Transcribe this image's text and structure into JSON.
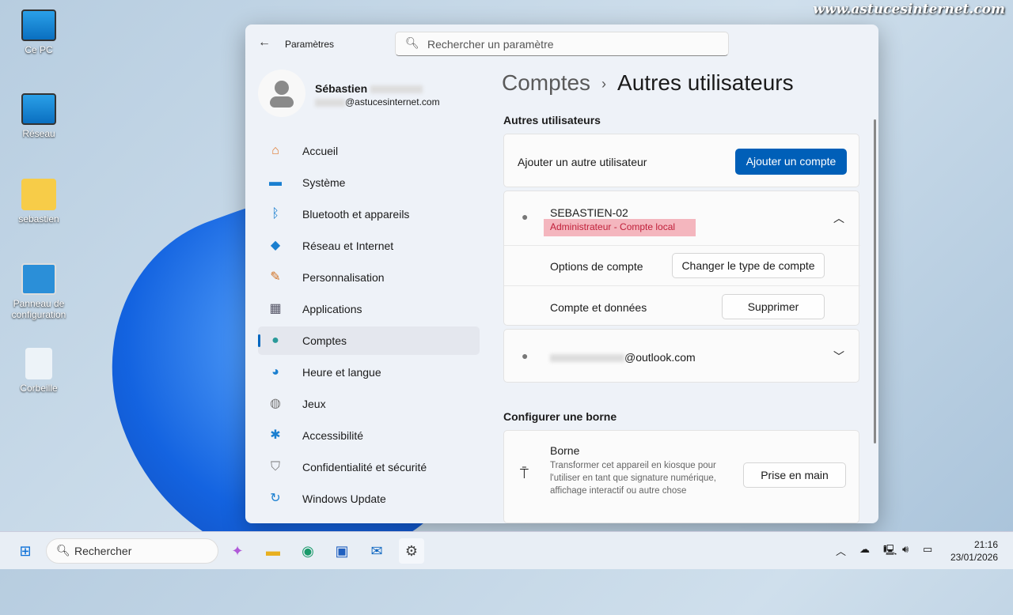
{
  "watermark": "www.astucesinternet.com",
  "desktop": [
    "Ce PC",
    "Réseau",
    "sebastien",
    "Panneau de configuration",
    "Corbeille"
  ],
  "window": {
    "title": "Paramètres",
    "search_placeholder": "Rechercher un paramètre"
  },
  "user": {
    "name": "Sébastien",
    "email_domain": "@astucesinternet.com"
  },
  "nav": [
    {
      "label": "Accueil",
      "icon": "home-icon"
    },
    {
      "label": "Système",
      "icon": "monitor-icon"
    },
    {
      "label": "Bluetooth et appareils",
      "icon": "bluetooth-icon"
    },
    {
      "label": "Réseau et Internet",
      "icon": "wifi-icon"
    },
    {
      "label": "Personnalisation",
      "icon": "brush-icon"
    },
    {
      "label": "Applications",
      "icon": "apps-icon"
    },
    {
      "label": "Comptes",
      "icon": "person-icon",
      "selected": true
    },
    {
      "label": "Heure et langue",
      "icon": "globe-clock-icon"
    },
    {
      "label": "Jeux",
      "icon": "gamepad-icon"
    },
    {
      "label": "Accessibilité",
      "icon": "accessibility-icon"
    },
    {
      "label": "Confidentialité et sécurité",
      "icon": "shield-icon"
    },
    {
      "label": "Windows Update",
      "icon": "update-icon"
    }
  ],
  "breadcrumb": {
    "parent": "Comptes",
    "current": "Autres utilisateurs"
  },
  "other_users": {
    "heading": "Autres utilisateurs",
    "add_label": "Ajouter un autre utilisateur",
    "add_button": "Ajouter un compte",
    "user1": {
      "name": "SEBASTIEN-02",
      "type": "Administrateur - Compte local",
      "options_label": "Options de compte",
      "options_button": "Changer le type de compte",
      "data_label": "Compte et données",
      "data_button": "Supprimer"
    },
    "user2": {
      "email_domain": "@outlook.com"
    }
  },
  "kiosk": {
    "heading": "Configurer une borne",
    "title": "Borne",
    "desc": "Transformer cet appareil en kiosque pour l'utiliser en tant que signature numérique, affichage interactif ou autre chose",
    "button": "Prise en main"
  },
  "taskbar": {
    "search": "Rechercher",
    "time": "21:16",
    "date": "23/01/2026"
  },
  "colors": {
    "accent": "#005fb8",
    "highlight": "#f4b6be"
  }
}
